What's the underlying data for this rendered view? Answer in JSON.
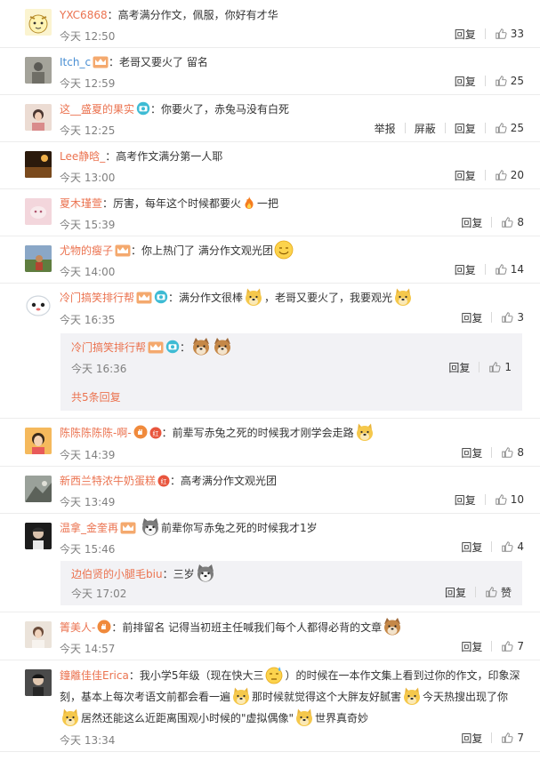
{
  "ui": {
    "reply_label": "回复",
    "report_label": "举报",
    "block_label": "屏蔽",
    "praise_label": "赞"
  },
  "comments": [
    {
      "name": "YXC6868",
      "text": "：高考满分作文，佩服，你好有才华",
      "time": "今天 12:50",
      "likes": "33"
    },
    {
      "name": "Itch_c",
      "text": "：老哥又要火了 留名",
      "time": "今天 12:59",
      "likes": "25"
    },
    {
      "name": "这__盛夏的果实",
      "text": "：你要火了，赤兔马没有白死",
      "time": "今天 12:25",
      "likes": "25"
    },
    {
      "name": "Lee静晗_",
      "text": "：高考作文满分第一人耶",
      "time": "今天 13:00",
      "likes": "20"
    },
    {
      "name": "夏木瑾萱",
      "text_a": "：厉害，每年这个时候都要火",
      "text_b": "一把",
      "time": "今天 15:39",
      "likes": "8"
    },
    {
      "name": "尤物的瘦子",
      "text": "：你上热门了 满分作文观光团",
      "time": "今天 14:00",
      "likes": "14"
    },
    {
      "name": "冷门搞笑排行帮",
      "text_a": "：满分作文很棒",
      "text_b": "，老哥又要火了，我要观光",
      "time": "今天 16:35",
      "likes": "3",
      "reply": {
        "name": "冷门搞笑排行帮",
        "text": "：",
        "time": "今天 16:36",
        "likes": "1",
        "more": "共5条回复"
      }
    },
    {
      "name": "陈陈陈陈陈-啊-",
      "text": "：前辈写赤兔之死的时候我才刚学会走路",
      "time": "今天 14:39",
      "likes": "8"
    },
    {
      "name": "新西兰特浓牛奶蛋糕",
      "text": "：高考满分作文观光团",
      "time": "今天 13:49",
      "likes": "10"
    },
    {
      "name": "温拿_金奎再",
      "text": "前辈你写赤兔之死的时候我才1岁",
      "time": "今天 15:46",
      "likes": "4",
      "reply": {
        "name": "边伯贤的小腿毛biu",
        "text": "：三岁",
        "time": "今天 17:02"
      }
    },
    {
      "name": "箐美人-",
      "text": "：前排留名 记得当初班主任喊我们每个人都得必背的文章",
      "time": "今天 14:57",
      "likes": "7"
    },
    {
      "name": "鐘離佳佳Erica",
      "t1": "：我小学5年级（现在快大三",
      "t2": "）的时候在一本作文集上看到过你的作文，印象深刻，基本上每次考语文前都会看一遍",
      "t3": "那时候就觉得这个大胖友好腻害",
      "t4": "今天热搜出现了你",
      "t5": "居然还能这么近距离围观小时候的\"虚拟偶像\"",
      "t6": "世界真奇妙",
      "time": "今天 13:34",
      "likes": "7"
    }
  ]
}
